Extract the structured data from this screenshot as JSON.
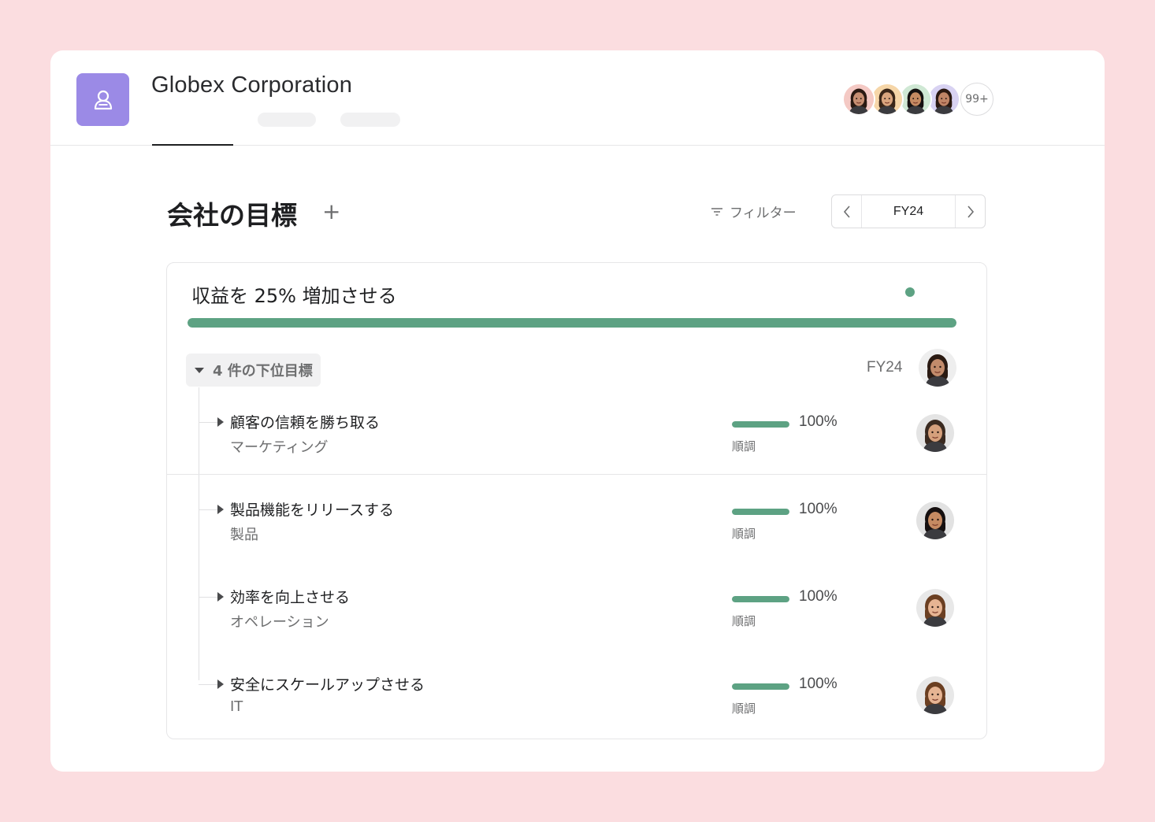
{
  "header": {
    "org_name": "Globex Corporation",
    "members_more": "99+",
    "members": [
      {
        "name": "member-1",
        "skin": "#c78f72",
        "hair": "#2b1a12",
        "bg": "#f4c9c4"
      },
      {
        "name": "member-2",
        "skin": "#d9a57e",
        "hair": "#3a2618",
        "bg": "#f6d6a8"
      },
      {
        "name": "member-3",
        "skin": "#c58a62",
        "hair": "#141010",
        "bg": "#cfe8d4"
      },
      {
        "name": "member-4",
        "skin": "#bf8466",
        "hair": "#2a1810",
        "bg": "#d8d2f2"
      }
    ]
  },
  "toolbar": {
    "page_title": "会社の目標",
    "add_label": "+",
    "filter_label": "フィルター",
    "period_value": "FY24"
  },
  "goal": {
    "title": "収益を 25% 増加させる",
    "progress": 1.0,
    "status_color": "#5da283",
    "subgoal_toggle_label": "4 件の下位目標",
    "period": "FY24",
    "owner": {
      "skin": "#c28b6b",
      "hair": "#2a1a12",
      "bg": "#eeeeee"
    }
  },
  "subgoals": [
    {
      "name": "顧客の信頼を勝ち取る",
      "team": "マーケティング",
      "percent_label": "100%",
      "progress": 1.0,
      "status": "順調",
      "owner": {
        "skin": "#d5a07c",
        "hair": "#3a2a20",
        "bg": "#e4e4e4"
      }
    },
    {
      "name": "製品機能をリリースする",
      "team": "製品",
      "percent_label": "100%",
      "progress": 1.0,
      "status": "順調",
      "owner": {
        "skin": "#c58a62",
        "hair": "#161010",
        "bg": "#e2e2e2"
      }
    },
    {
      "name": "効率を向上させる",
      "team": "オペレーション",
      "percent_label": "100%",
      "progress": 1.0,
      "status": "順調",
      "owner": {
        "skin": "#e6b493",
        "hair": "#6b3f22",
        "bg": "#e8e8e8"
      }
    },
    {
      "name": "安全にスケールアップさせる",
      "team": "IT",
      "percent_label": "100%",
      "progress": 1.0,
      "status": "順調",
      "owner": {
        "skin": "#e6b493",
        "hair": "#6b3f22",
        "bg": "#e8e8e8"
      }
    }
  ],
  "colors": {
    "background": "#fbdde0",
    "accent": "#9b8ae6",
    "progress": "#5da283"
  }
}
